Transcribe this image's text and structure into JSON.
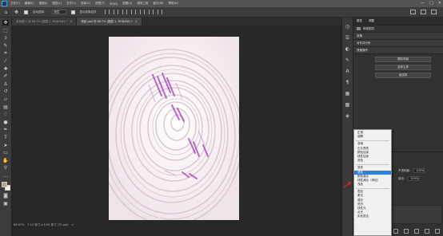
{
  "menubar": {
    "logo": "Ps",
    "items": [
      "文件(F)",
      "编辑(E)",
      "图像(I)",
      "图层(L)",
      "文字(Y)",
      "选择(S)",
      "滤镜(T)",
      "3D(D)",
      "视图(V)",
      "增效工具",
      "窗口(W)",
      "帮助(H)"
    ],
    "window_controls": [
      "—",
      "□",
      "✕"
    ]
  },
  "options_bar": {
    "auto_select_label": "自动选择：",
    "auto_select_value": "图层",
    "transform_label": "显示变换控件"
  },
  "tabs": [
    {
      "label": "未标题-1 @ 66.7% (图层 1, RGB/8#) *",
      "active": false
    },
    {
      "label": "壳纹.psd @ 66.7% (图层 1, RGB/8#) *",
      "active": true
    }
  ],
  "status_bar": {
    "zoom": "66.67%",
    "doc_size": "7.12 英寸 x 9.94 英寸 (72 ppi)",
    "arrow": ">"
  },
  "panels": {
    "tabs": [
      "属性",
      "调整"
    ],
    "rows": [
      "像素图层",
      "变换",
      "对齐并分布"
    ],
    "quick_actions_title": "快速操作",
    "quick_actions": [
      "删除背景",
      "选择主体",
      "面选择"
    ]
  },
  "layers_panel": {
    "opacity_label": "不透明度:",
    "opacity_value": "100%",
    "fill_label": "填充:",
    "fill_value": "100%"
  },
  "blend_menu": {
    "groups": [
      [
        "正常",
        "溶解"
      ],
      [
        "变暗",
        "正片叠底",
        "颜色加深",
        "线性加深",
        "深色"
      ],
      [
        "变亮",
        "滤色",
        "颜色减淡",
        "线性减淡（添加）",
        "浅色"
      ],
      [
        "叠加",
        "柔光",
        "强光",
        "亮光",
        "线性光",
        "点光",
        "实色混合"
      ]
    ],
    "selected": "滤色"
  },
  "colors": {
    "foreground": "#b9a577",
    "background": "#f2efe4",
    "selection": "#2e7fd8",
    "accent_purple": "#a23bb6"
  }
}
